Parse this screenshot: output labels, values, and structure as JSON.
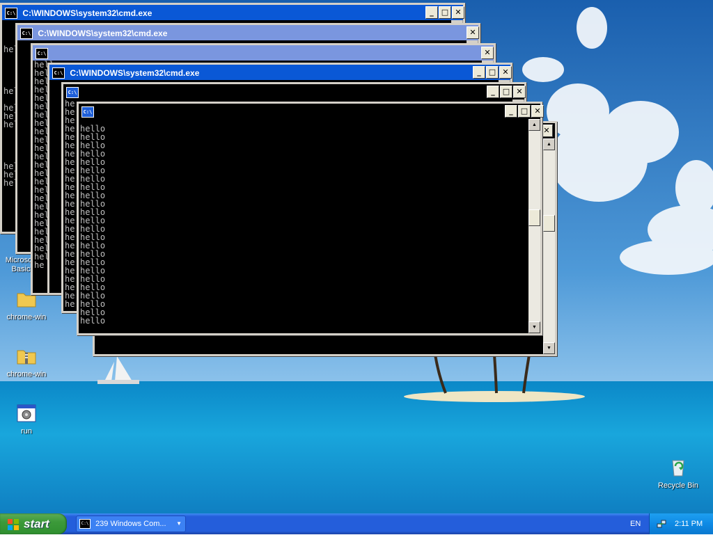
{
  "windows": {
    "w1_title": "C:\\WINDOWS\\system32\\cmd.exe",
    "w2_title": "C:\\WINDOWS\\system32\\cmd.exe",
    "w4_title": "C:\\WINDOWS\\system32\\cmd.exe",
    "icon_glyph": "C:\\",
    "output_line": "hello",
    "output_fragment_4": "hell",
    "output_fragment_2": "he",
    "output_fragment_3": "hel",
    "minimize_glyph": "_",
    "maximize_glyph": "□",
    "close_glyph": "✕"
  },
  "desktop_icons": [
    {
      "label": "Microsoft Basic",
      "label_line1": "Microsoft",
      "label_line2": "Basic",
      "icon": "app-icon"
    },
    {
      "label": "chrome-win",
      "icon": "folder-icon"
    },
    {
      "label": "chrome-win",
      "icon": "zip-folder-icon"
    },
    {
      "label": "run",
      "icon": "run-app-icon"
    },
    {
      "label": "Recycle Bin",
      "icon": "recycle-bin-icon"
    }
  ],
  "taskbar": {
    "start_label": "start",
    "group_label": "239 Windows Com...",
    "language": "EN",
    "clock": "2:11 PM"
  },
  "colors": {
    "titlebar_active": "#0a58d6",
    "titlebar_inactive": "#7a96df",
    "taskbar": "#245edb",
    "start_green": "#3c9a3a"
  }
}
